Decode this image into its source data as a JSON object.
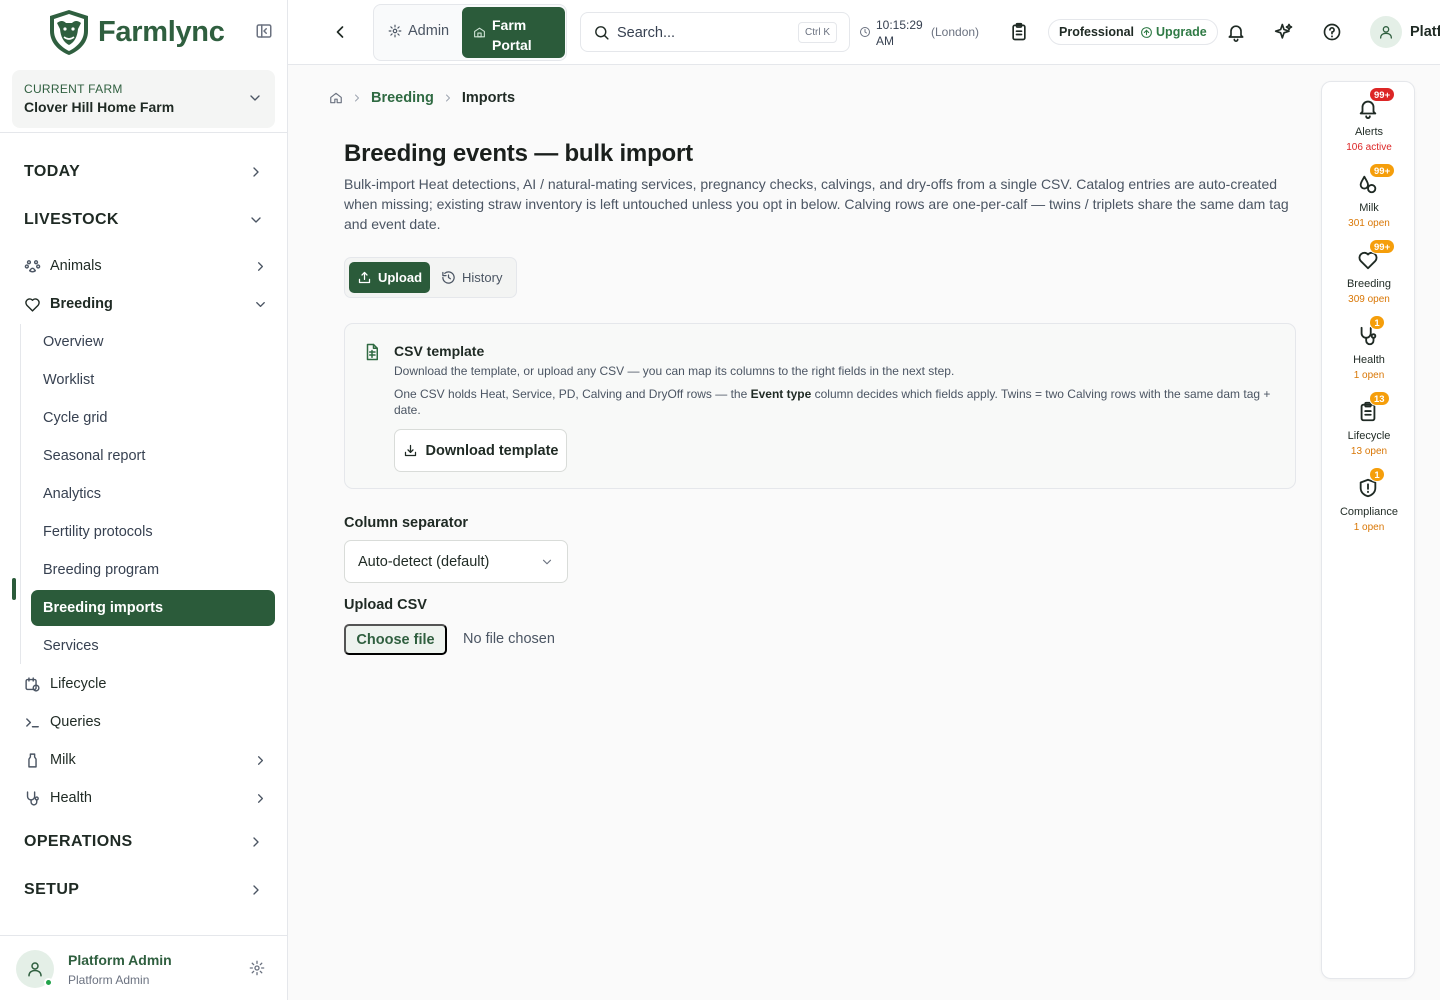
{
  "colors": {
    "brand": "#2b5b3a",
    "alert_red": "#dc2626",
    "badge_amber": "#f59e0b",
    "amber_text": "#d97706"
  },
  "brand": {
    "name": "Farmlync"
  },
  "farm": {
    "label": "CURRENT FARM",
    "name": "Clover Hill Home Farm"
  },
  "nav": {
    "today": "TODAY",
    "livestock": "LIVESTOCK",
    "animals": "Animals",
    "breeding": "Breeding",
    "breeding_sub": [
      "Overview",
      "Worklist",
      "Cycle grid",
      "Seasonal report",
      "Analytics",
      "Fertility protocols",
      "Breeding program",
      "Breeding imports",
      "Services"
    ],
    "lifecycle": "Lifecycle",
    "queries": "Queries",
    "milk": "Milk",
    "health": "Health",
    "operations": "OPERATIONS",
    "setup": "SETUP"
  },
  "user": {
    "name": "Platform Admin",
    "role": "Platform Admin",
    "top_name": "Platf"
  },
  "topbar": {
    "admin_label": "Admin",
    "farm_portal_label": "Farm Portal",
    "search_placeholder": "Search...",
    "search_shortcut": "Ctrl K",
    "time": "10:15:29 AM",
    "timezone": "(London)",
    "plan": "Professional",
    "upgrade": "Upgrade"
  },
  "breadcrumb": {
    "parent": "Breeding",
    "current": "Imports"
  },
  "page": {
    "title": "Breeding events — bulk import",
    "description": "Bulk-import Heat detections, AI / natural-mating services, pregnancy checks, calvings, and dry-offs from a single CSV. Catalog entries are auto-created when missing; existing straw inventory is left untouched unless you opt in below. Calving rows are one-per-calf — twins / triplets share the same dam tag and event date."
  },
  "tabs": {
    "upload": "Upload",
    "history": "History"
  },
  "template_card": {
    "title": "CSV template",
    "line1": "Download the template, or upload any CSV — you can map its columns to the right fields in the next step.",
    "line2_pre": "One CSV holds Heat, Service, PD, Calving and DryOff rows — the ",
    "line2_bold": "Event type",
    "line2_post": " column decides which fields apply. Twins = two Calving rows with the same dam tag + date.",
    "button": "Download template"
  },
  "separator": {
    "label": "Column separator",
    "value": "Auto-detect (default)"
  },
  "upload": {
    "label": "Upload CSV",
    "button": "Choose file",
    "status": "No file chosen"
  },
  "rail": [
    {
      "label": "Alerts",
      "badge": "99+",
      "sub": "106 active"
    },
    {
      "label": "Milk",
      "badge": "99+",
      "sub": "301 open"
    },
    {
      "label": "Breeding",
      "badge": "99+",
      "sub": "309 open"
    },
    {
      "label": "Health",
      "badge": "1",
      "sub": "1 open"
    },
    {
      "label": "Lifecycle",
      "badge": "13",
      "sub": "13 open"
    },
    {
      "label": "Compliance",
      "badge": "1",
      "sub": "1 open"
    }
  ]
}
